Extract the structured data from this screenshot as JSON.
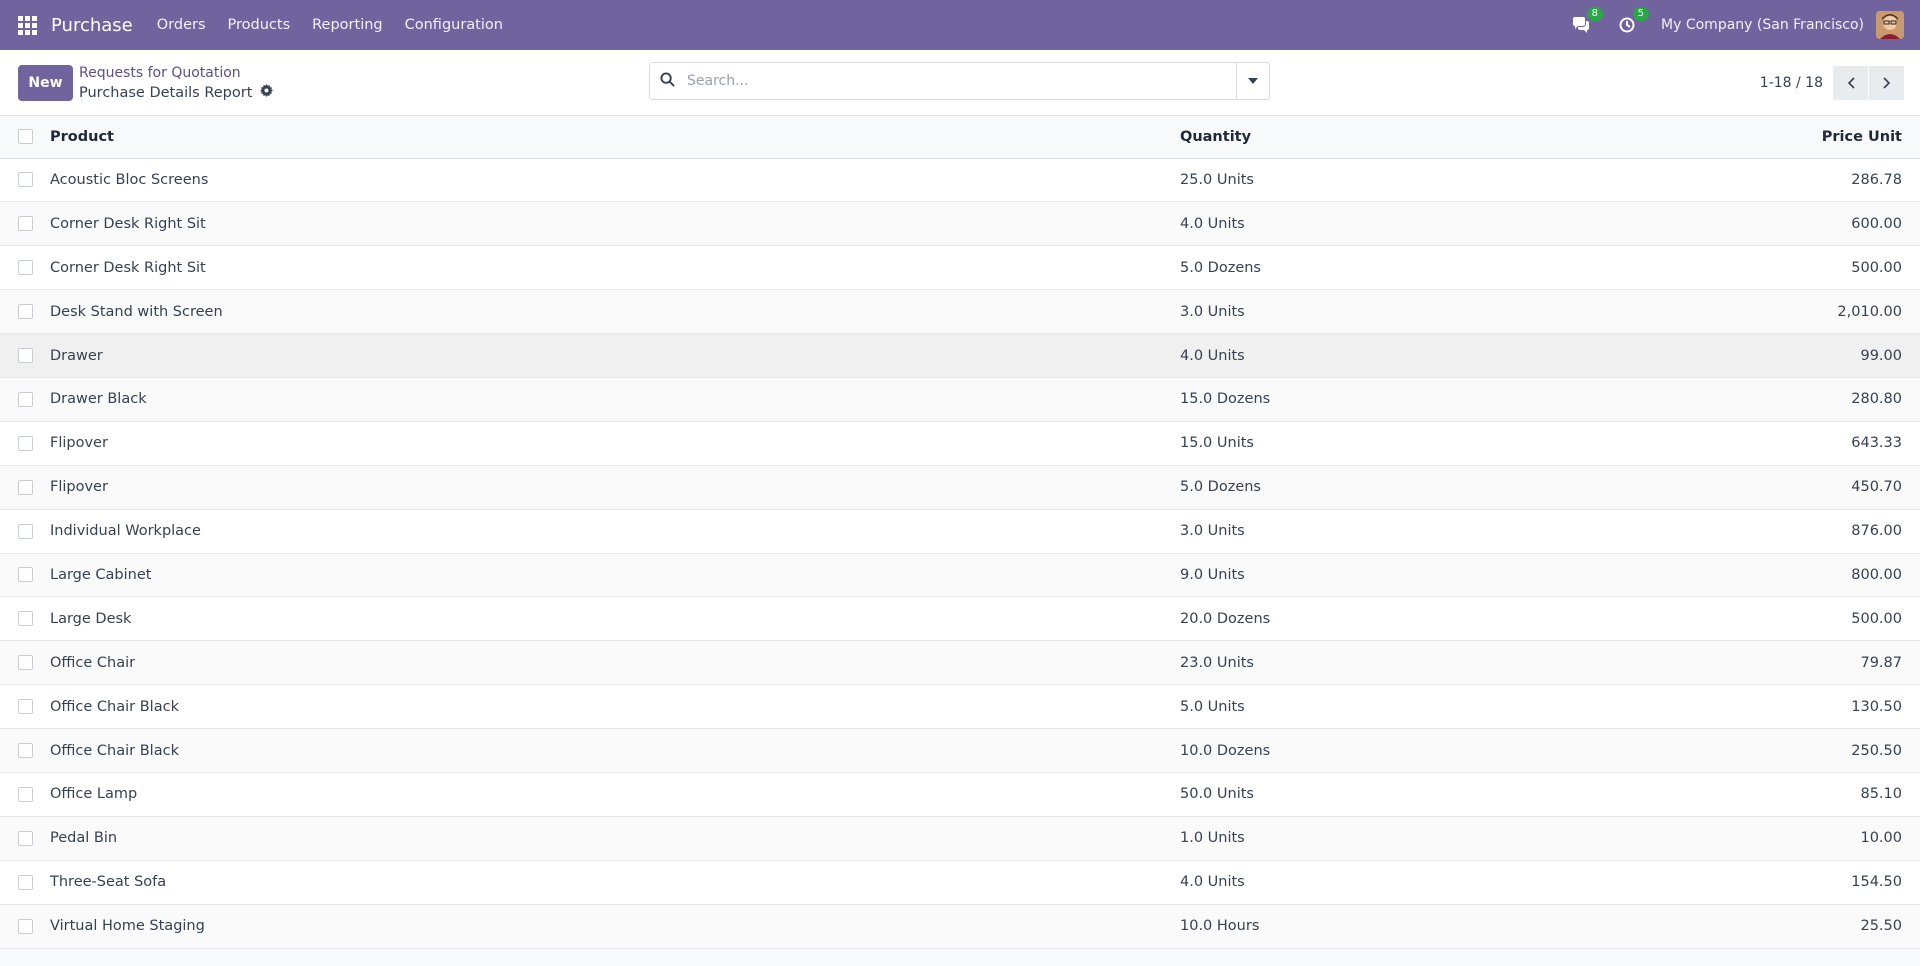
{
  "navbar": {
    "app_name": "Purchase",
    "menu": [
      "Orders",
      "Products",
      "Reporting",
      "Configuration"
    ],
    "messages_count": "8",
    "activities_count": "5",
    "company": "My Company (San Francisco)"
  },
  "control": {
    "new_label": "New",
    "breadcrumb_parent": "Requests for Quotation",
    "breadcrumb_current": "Purchase Details Report",
    "search_placeholder": "Search...",
    "pager": "1-18 / 18"
  },
  "table": {
    "headers": {
      "product": "Product",
      "quantity": "Quantity",
      "price": "Price Unit"
    },
    "rows": [
      {
        "product": "Acoustic Bloc Screens",
        "quantity": "25.0 Units",
        "price": "286.78"
      },
      {
        "product": "Corner Desk Right Sit",
        "quantity": "4.0 Units",
        "price": "600.00"
      },
      {
        "product": "Corner Desk Right Sit",
        "quantity": "5.0 Dozens",
        "price": "500.00"
      },
      {
        "product": "Desk Stand with Screen",
        "quantity": "3.0 Units",
        "price": "2,010.00"
      },
      {
        "product": "Drawer",
        "quantity": "4.0 Units",
        "price": "99.00"
      },
      {
        "product": "Drawer Black",
        "quantity": "15.0 Dozens",
        "price": "280.80"
      },
      {
        "product": "Flipover",
        "quantity": "15.0 Units",
        "price": "643.33"
      },
      {
        "product": "Flipover",
        "quantity": "5.0 Dozens",
        "price": "450.70"
      },
      {
        "product": "Individual Workplace",
        "quantity": "3.0 Units",
        "price": "876.00"
      },
      {
        "product": "Large Cabinet",
        "quantity": "9.0 Units",
        "price": "800.00"
      },
      {
        "product": "Large Desk",
        "quantity": "20.0 Dozens",
        "price": "500.00"
      },
      {
        "product": "Office Chair",
        "quantity": "23.0 Units",
        "price": "79.87"
      },
      {
        "product": "Office Chair Black",
        "quantity": "5.0 Units",
        "price": "130.50"
      },
      {
        "product": "Office Chair Black",
        "quantity": "10.0 Dozens",
        "price": "250.50"
      },
      {
        "product": "Office Lamp",
        "quantity": "50.0 Units",
        "price": "85.10"
      },
      {
        "product": "Pedal Bin",
        "quantity": "1.0 Units",
        "price": "10.00"
      },
      {
        "product": "Three-Seat Sofa",
        "quantity": "4.0 Units",
        "price": "154.50"
      },
      {
        "product": "Virtual Home Staging",
        "quantity": "10.0 Hours",
        "price": "25.50"
      }
    ]
  },
  "colors": {
    "brand": "#71639e",
    "badge": "#28a745"
  }
}
